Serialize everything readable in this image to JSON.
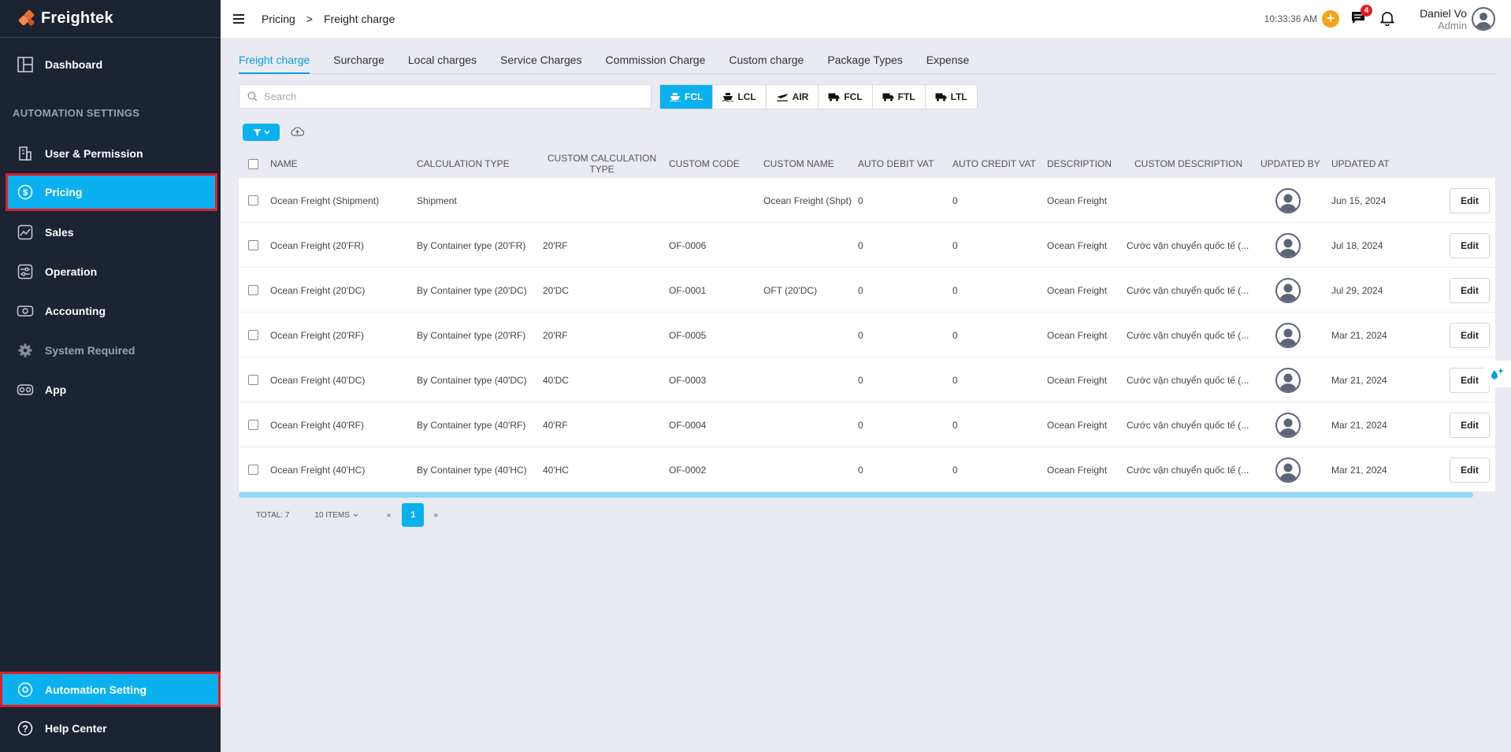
{
  "app": {
    "name": "Freightek"
  },
  "sidebar": {
    "dashboard": "Dashboard",
    "section_label": "AUTOMATION SETTINGS",
    "items": [
      {
        "label": "User & Permission",
        "icon": "users-icon"
      },
      {
        "label": "Pricing",
        "icon": "dollar-icon"
      },
      {
        "label": "Sales",
        "icon": "chart-icon"
      },
      {
        "label": "Operation",
        "icon": "operation-icon"
      },
      {
        "label": "Accounting",
        "icon": "money-icon"
      },
      {
        "label": "System Required",
        "icon": "gear-icon"
      },
      {
        "label": "App",
        "icon": "app-icon"
      }
    ],
    "automation_setting": "Automation Setting",
    "help_center": "Help Center"
  },
  "header": {
    "breadcrumb": [
      "Pricing",
      ">",
      "Freight charge"
    ],
    "time": "10:33:36 AM",
    "notification_count": "4",
    "user_name": "Daniel Vo",
    "user_role": "Admin"
  },
  "tabs": [
    "Freight charge",
    "Surcharge",
    "Local charges",
    "Service Charges",
    "Commission Charge",
    "Custom charge",
    "Package Types",
    "Expense"
  ],
  "search": {
    "placeholder": "Search"
  },
  "modes": [
    "FCL",
    "LCL",
    "AIR",
    "FCL",
    "FTL",
    "LTL"
  ],
  "table": {
    "columns": [
      "NAME",
      "CALCULATION TYPE",
      "CUSTOM CALCULATION",
      "TYPE",
      "CUSTOM CODE",
      "CUSTOM NAME",
      "AUTO DEBIT VAT",
      "AUTO CREDIT VAT",
      "DESCRIPTION",
      "CUSTOM DESCRIPTION",
      "UPDATED BY",
      "UPDATED AT"
    ],
    "edit_label": "Edit",
    "rows": [
      {
        "name": "Ocean Freight (Shipment)",
        "calc_type": "Shipment",
        "custom_calc": "",
        "code": "",
        "custom_name": "Ocean Freight (Shpt)",
        "debit": "0",
        "credit": "0",
        "desc": "Ocean Freight",
        "custom_desc": "",
        "updated_at": "Jun 15, 2024"
      },
      {
        "name": "Ocean Freight (20'FR)",
        "calc_type": "By Container type (20'FR)",
        "custom_calc": "20'RF",
        "code": "OF-0006",
        "custom_name": "",
        "debit": "0",
        "credit": "0",
        "desc": "Ocean Freight",
        "custom_desc": "Cước vận chuyển quốc tế (...",
        "updated_at": "Jul 18, 2024"
      },
      {
        "name": "Ocean Freight (20'DC)",
        "calc_type": "By Container type (20'DC)",
        "custom_calc": "20'DC",
        "code": "OF-0001",
        "custom_name": "OFT (20'DC)",
        "debit": "0",
        "credit": "0",
        "desc": "Ocean Freight",
        "custom_desc": "Cước vận chuyển quốc tế (...",
        "updated_at": "Jul 29, 2024"
      },
      {
        "name": "Ocean Freight (20'RF)",
        "calc_type": "By Container type (20'RF)",
        "custom_calc": "20'RF",
        "code": "OF-0005",
        "custom_name": "",
        "debit": "0",
        "credit": "0",
        "desc": "Ocean Freight",
        "custom_desc": "Cước vận chuyển quốc tế (...",
        "updated_at": "Mar 21, 2024"
      },
      {
        "name": "Ocean Freight (40'DC)",
        "calc_type": "By Container type (40'DC)",
        "custom_calc": "40'DC",
        "code": "OF-0003",
        "custom_name": "",
        "debit": "0",
        "credit": "0",
        "desc": "Ocean Freight",
        "custom_desc": "Cước vận chuyển quốc tế (...",
        "updated_at": "Mar 21, 2024"
      },
      {
        "name": "Ocean Freight (40'RF)",
        "calc_type": "By Container type (40'RF)",
        "custom_calc": "40'RF",
        "code": "OF-0004",
        "custom_name": "",
        "debit": "0",
        "credit": "0",
        "desc": "Ocean Freight",
        "custom_desc": "Cước vận chuyển quốc tế (...",
        "updated_at": "Mar 21, 2024"
      },
      {
        "name": "Ocean Freight (40'HC)",
        "calc_type": "By Container type (40'HC)",
        "custom_calc": "40'HC",
        "code": "OF-0002",
        "custom_name": "",
        "debit": "0",
        "credit": "0",
        "desc": "Ocean Freight",
        "custom_desc": "Cước vận chuyển quốc tế (...",
        "updated_at": "Mar 21, 2024"
      }
    ]
  },
  "pagination": {
    "total": "TOTAL: 7",
    "page_size": "10 ITEMS",
    "prev": "«",
    "current": "1",
    "next": "»"
  },
  "colors": {
    "accent": "#0ab1ee",
    "sidebar_bg": "#1c2333",
    "highlight": "#e51b23",
    "orange": "#f7a21b"
  }
}
